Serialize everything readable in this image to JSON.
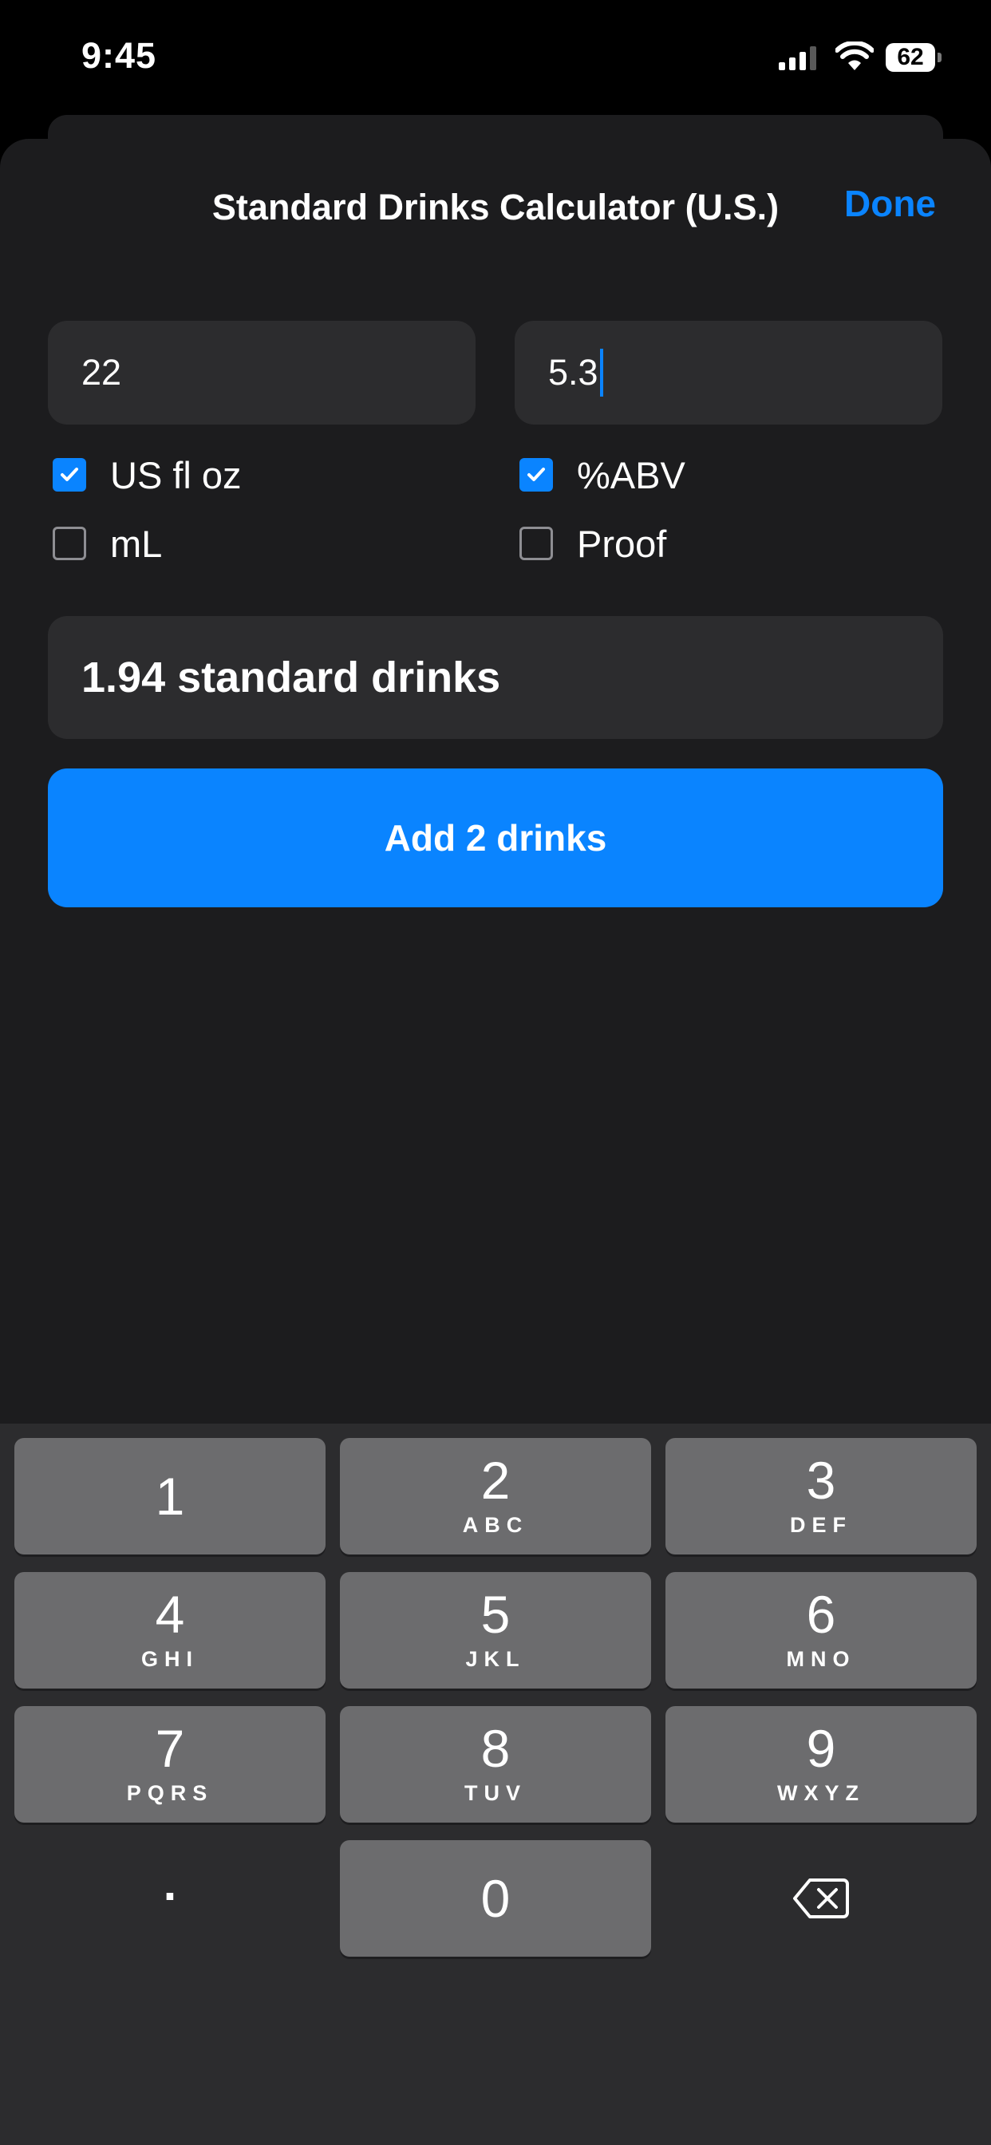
{
  "status_bar": {
    "time": "9:45",
    "battery_level": "62",
    "signal_icon": "signal-icon",
    "wifi_icon": "wifi-icon"
  },
  "sheet": {
    "title": "Standard Drinks Calculator (U.S.)",
    "done_label": "Done"
  },
  "inputs": {
    "volume_value": "22",
    "abv_value": "5.3"
  },
  "options": {
    "volume_units": [
      {
        "label": "US fl oz",
        "checked": true
      },
      {
        "label": "mL",
        "checked": false
      }
    ],
    "strength_units": [
      {
        "label": "%ABV",
        "checked": true
      },
      {
        "label": "Proof",
        "checked": false
      }
    ]
  },
  "result": {
    "text": "1.94 standard drinks"
  },
  "add_button": {
    "label": "Add 2 drinks"
  },
  "keypad": {
    "keys": [
      {
        "digit": "1",
        "letters": ""
      },
      {
        "digit": "2",
        "letters": "ABC"
      },
      {
        "digit": "3",
        "letters": "DEF"
      },
      {
        "digit": "4",
        "letters": "GHI"
      },
      {
        "digit": "5",
        "letters": "JKL"
      },
      {
        "digit": "6",
        "letters": "MNO"
      },
      {
        "digit": "7",
        "letters": "PQRS"
      },
      {
        "digit": "8",
        "letters": "TUV"
      },
      {
        "digit": "9",
        "letters": "WXYZ"
      },
      {
        "digit": "0",
        "letters": ""
      }
    ],
    "decimal": ".",
    "delete_icon": "backspace-icon"
  },
  "colors": {
    "accent": "#0a84ff",
    "sheet_bg": "#1c1c1e",
    "field_bg": "#2c2c2e",
    "key_bg": "#6c6c6e"
  }
}
